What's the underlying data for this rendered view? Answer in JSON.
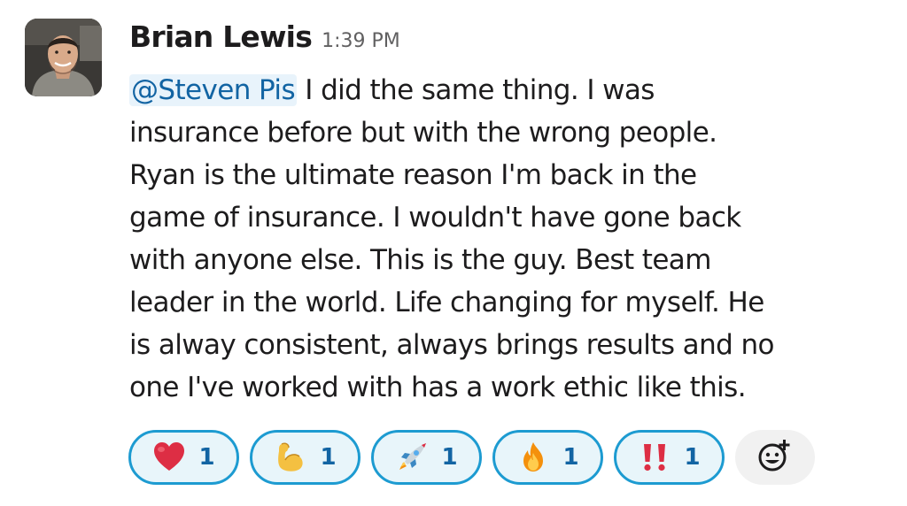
{
  "message": {
    "author": "Brian Lewis",
    "timestamp": "1:39 PM",
    "avatar_icon": "user-avatar-photo",
    "mention": "@Steven Pis",
    "text_lines": [
      " I did the same thing. I was",
      "insurance before but with the wrong people.",
      "Ryan is the ultimate reason I'm back in the",
      "game of insurance. I wouldn't have gone back",
      "with anyone else. This is the guy. Best team",
      "leader in the world. Life changing for myself. He",
      "is alway consistent, always brings results and no",
      "one I've worked with has a work ethic like this."
    ]
  },
  "reactions": [
    {
      "emoji": "heart",
      "count": "1"
    },
    {
      "emoji": "flexed-biceps",
      "count": "1"
    },
    {
      "emoji": "rocket",
      "count": "1"
    },
    {
      "emoji": "fire",
      "count": "1"
    },
    {
      "emoji": "double-exclamation",
      "count": "1"
    }
  ],
  "add_reaction_icon": "add-reaction-icon",
  "colors": {
    "mention_bg": "#e8f3fb",
    "mention_text": "#1264a3",
    "reaction_border": "#1d9bd1",
    "reaction_bg": "#e8f5fa",
    "reaction_count": "#1264a3",
    "timestamp": "#616061"
  }
}
